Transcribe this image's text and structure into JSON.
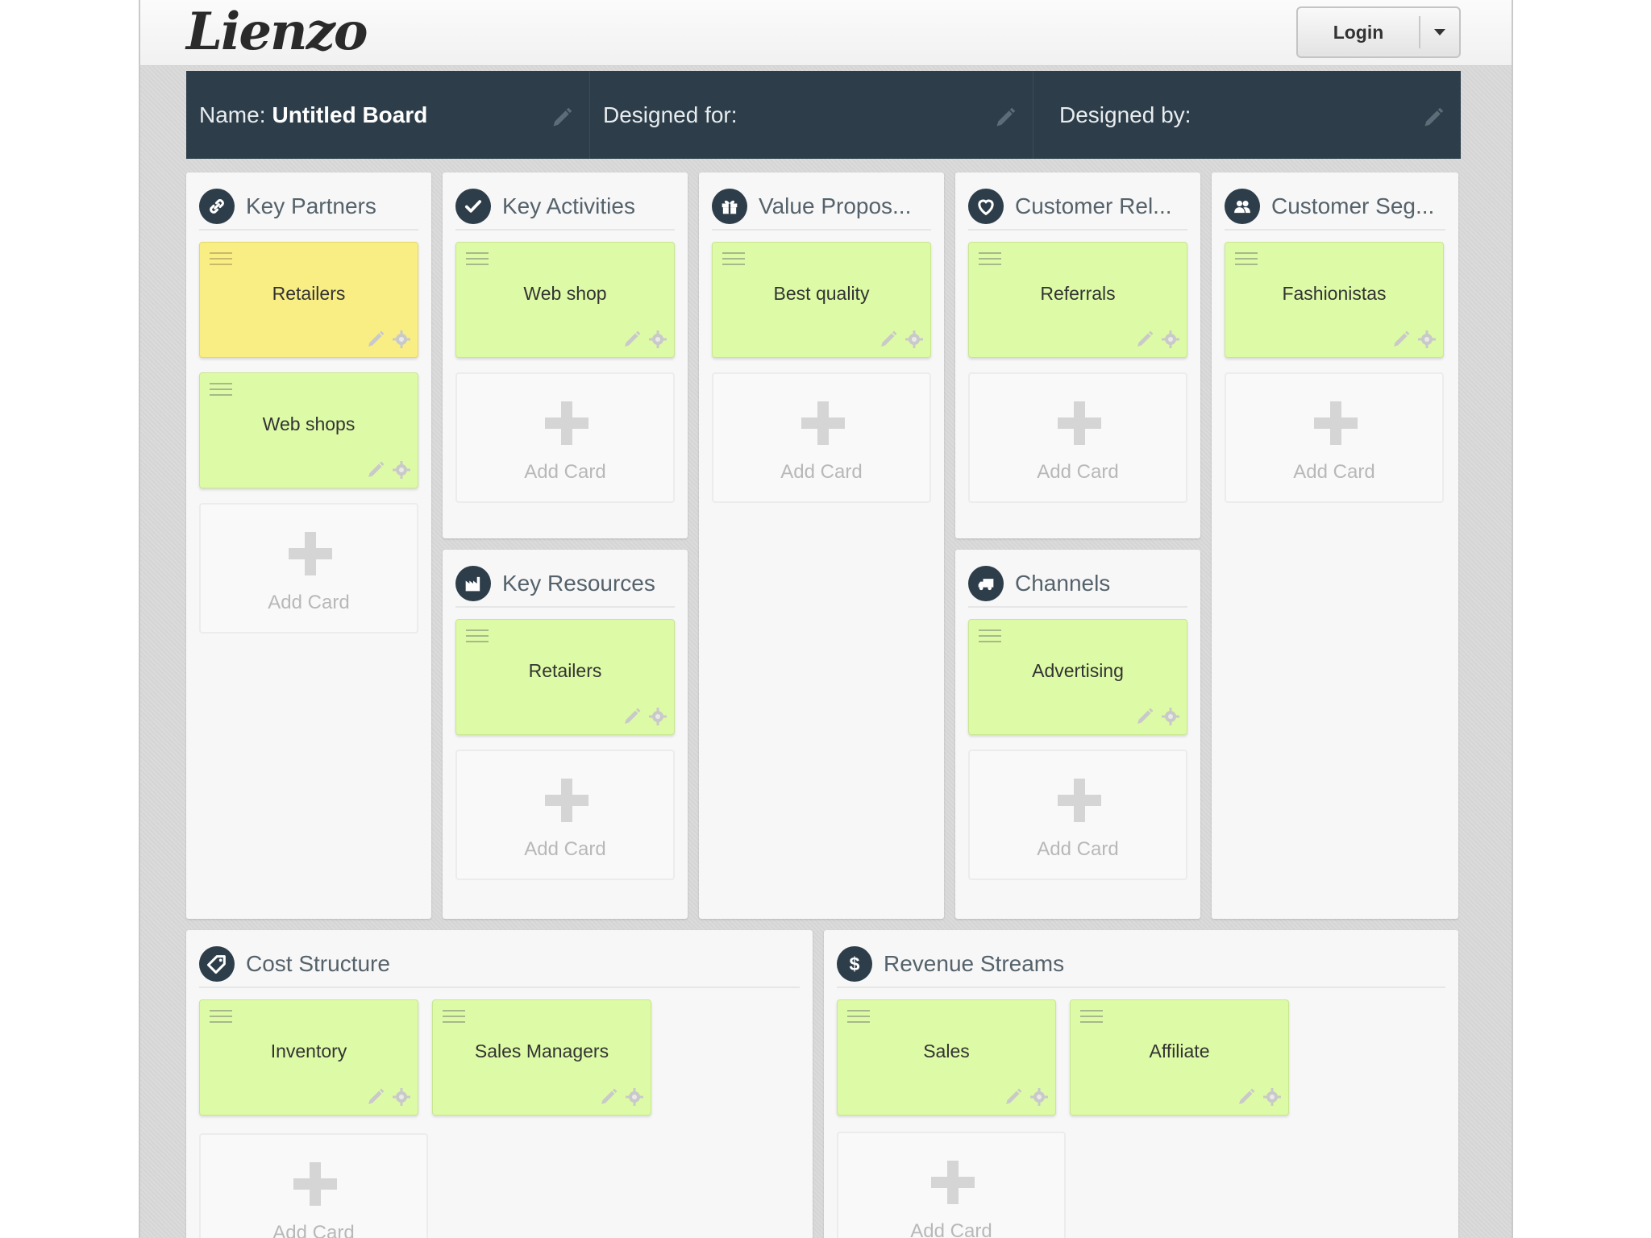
{
  "app": {
    "logo": "Lienzo",
    "login_label": "Login"
  },
  "board": {
    "name_label": "Name:",
    "name_value": "Untitled Board",
    "designed_for_label": "Designed for:",
    "designed_by_label": "Designed by:"
  },
  "add_card_label": "Add Card",
  "blocks": {
    "key_partners": {
      "title": "Key Partners",
      "icon": "link-icon",
      "cards": [
        {
          "text": "Retailers",
          "color": "#f9ee84"
        },
        {
          "text": "Web shops",
          "color": "#ddfba6"
        }
      ]
    },
    "key_activities": {
      "title": "Key Activities",
      "icon": "check-icon",
      "cards": [
        {
          "text": "Web shop",
          "color": "#ddfba6"
        }
      ]
    },
    "key_resources": {
      "title": "Key Resources",
      "icon": "factory-icon",
      "cards": [
        {
          "text": "Retailers",
          "color": "#ddfba6"
        }
      ]
    },
    "value_propositions": {
      "title": "Value Propos...",
      "icon": "gift-icon",
      "cards": [
        {
          "text": "Best quality",
          "color": "#ddfba6"
        }
      ]
    },
    "customer_relationships": {
      "title": "Customer Rel...",
      "icon": "heart-icon",
      "cards": [
        {
          "text": "Referrals",
          "color": "#ddfba6"
        }
      ]
    },
    "channels": {
      "title": "Channels",
      "icon": "truck-icon",
      "cards": [
        {
          "text": "Advertising",
          "color": "#ddfba6"
        }
      ]
    },
    "customer_segments": {
      "title": "Customer Seg...",
      "icon": "users-icon",
      "cards": [
        {
          "text": "Fashionistas",
          "color": "#ddfba6"
        }
      ]
    },
    "cost_structure": {
      "title": "Cost Structure",
      "icon": "tag-icon",
      "cards": [
        {
          "text": "Inventory",
          "color": "#ddfba6"
        },
        {
          "text": "Sales Managers",
          "color": "#ddfba6"
        }
      ]
    },
    "revenue_streams": {
      "title": "Revenue Streams",
      "icon": "dollar-icon",
      "cards": [
        {
          "text": "Sales",
          "color": "#ddfba6"
        },
        {
          "text": "Affiliate",
          "color": "#ddfba6"
        }
      ]
    }
  },
  "colors": {
    "header_bar": "#2d3e4a",
    "card_green": "#ddfba6",
    "card_yellow": "#f9ee84",
    "background": "#d9d9d9"
  }
}
